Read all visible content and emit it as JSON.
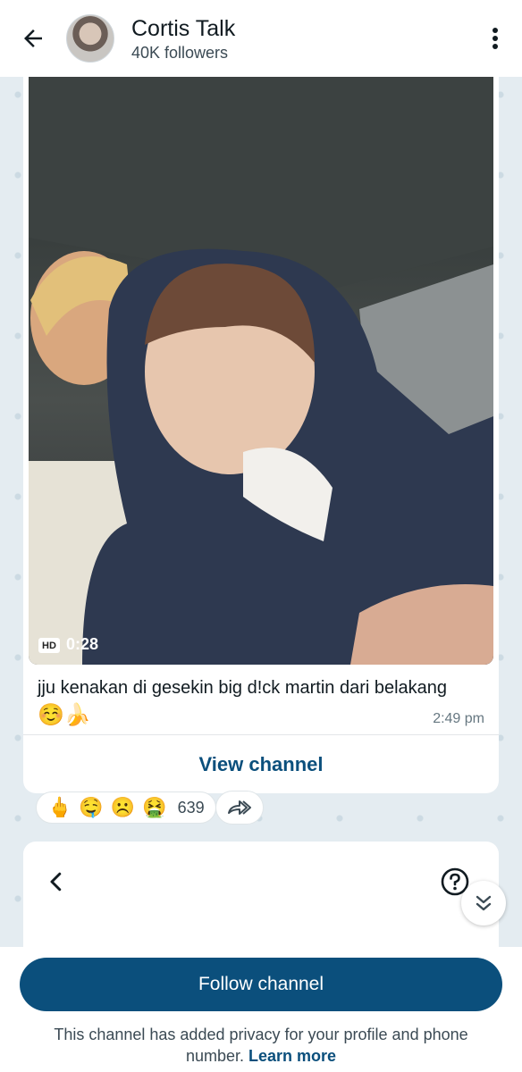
{
  "header": {
    "title": "Cortis Talk",
    "subtitle": "40K followers"
  },
  "message": {
    "video_badge": "HD",
    "video_duration": "0:28",
    "caption": "jju kenakan di gesekin big d!ck martin dari belakang",
    "caption_emojis": "☺️🍌",
    "time": "2:49 pm",
    "view_channel_label": "View channel"
  },
  "reactions": {
    "emojis": [
      "🖕",
      "🤤",
      "☹️",
      "🤮"
    ],
    "count": "639"
  },
  "footer": {
    "follow_label": "Follow channel",
    "privacy_text": "This channel has added privacy for your profile and phone number.",
    "learn_more": "Learn more"
  }
}
